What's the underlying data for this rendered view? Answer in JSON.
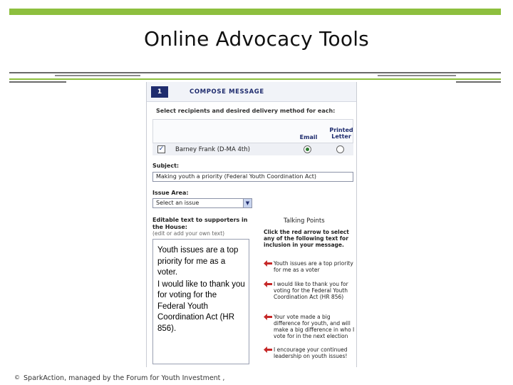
{
  "slide": {
    "title": "Online Advocacy Tools",
    "footer_mark": "©",
    "footer_text": "SparkAction, managed by the Forum for Youth Investment ,"
  },
  "colors": {
    "accent_green": "#8dbf3e",
    "rule_gray": "#707070",
    "rule_green": "#8dbf3e",
    "step_navy": "#1f2c6e",
    "arrow_red": "#c62828"
  },
  "form": {
    "step_number": "1",
    "step_title": "COMPOSE MESSAGE",
    "recipients_label": "Select recipients and desired delivery method for each:",
    "col_email": "Email",
    "col_printed": "Printed Letter",
    "recipient": {
      "checked_glyph": "✓",
      "name": "Barney Frank (D-MA 4th)",
      "email_selected": true
    },
    "subject_label": "Subject:",
    "subject_value": "Making youth a priority (Federal Youth Coordination Act)",
    "issue_label": "Issue Area:",
    "issue_value": "Select an issue",
    "issue_arrow_icon": "chevron-down-icon",
    "editable_label": "Editable text to supporters in the House:",
    "edit_hint": "(edit or add your own text)",
    "editable_para1": "Youth issues are a top priority for me as a voter.",
    "editable_para2": "I would like to thank you for voting for the Federal Youth Coordination Act (HR 856).",
    "talking_points": {
      "title": "Talking Points",
      "intro": "Click the red arrow to select any of the following text for inclusion in your message.",
      "items": [
        "Youth issues are a top priority for me as a voter",
        "I would like to thank you for voting for the Federal Youth Coordination Act (HR 856)",
        "Your vote made a big difference for youth, and will make a big difference in who I vote for in the next election",
        "I encourage your continued leadership on youth issues!"
      ]
    }
  }
}
